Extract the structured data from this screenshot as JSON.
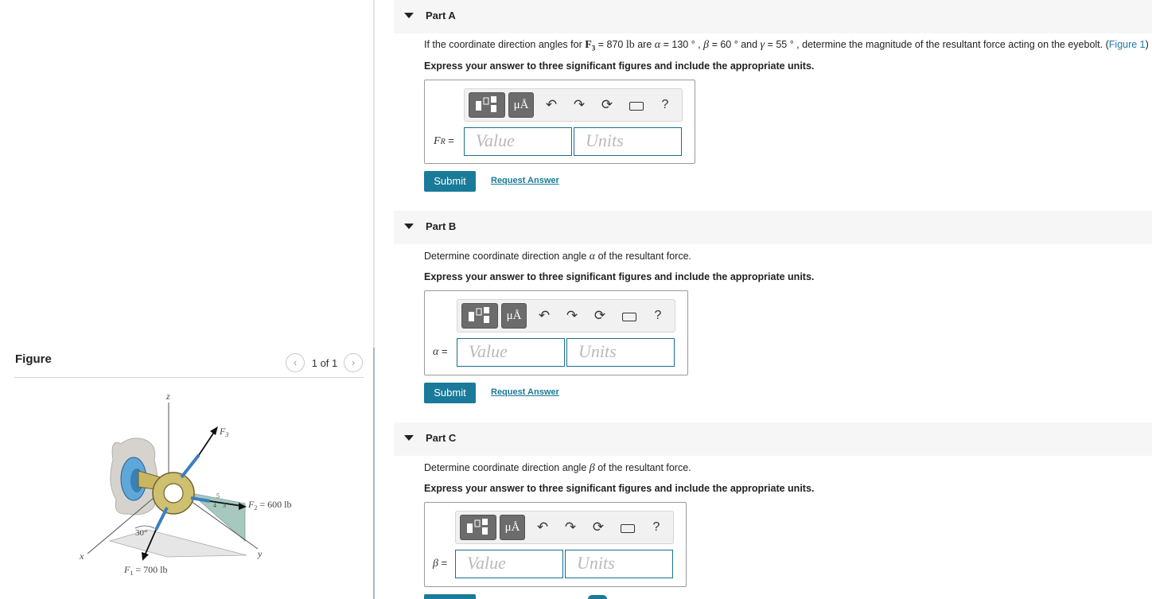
{
  "figure": {
    "title": "Figure",
    "pager": "1 of 1",
    "prev_icon": "‹",
    "next_icon": "›",
    "labels": {
      "z": "z",
      "y": "y",
      "x": "x",
      "f3": "F",
      "f3_sub": "3",
      "f2": "F",
      "f2_sub": "2",
      "f2_value": " = 600 lb",
      "f1": "F",
      "f1_sub": "1",
      "f1_value": " = 700 lb",
      "angle": "30°",
      "slope_5": "5",
      "slope_4": "4",
      "slope_3": "3"
    }
  },
  "toolbar": {
    "units_glyph": "μÅ",
    "undo_glyph": "↶",
    "redo_glyph": "↷",
    "reset_glyph": "⟳",
    "help_glyph": "?"
  },
  "parts": [
    {
      "title": "Part A",
      "question": {
        "prefix": "If the coordinate direction angles for ",
        "force": "F",
        "force_sub": "3",
        "mid1": " = 870 ",
        "unit": "lb",
        "mid2": " are ",
        "alpha": "α",
        "alpha_val": " = 130 ° , ",
        "beta": "β",
        "beta_val": " = 60 ° and ",
        "gamma": "γ",
        "gamma_val": " = 55 ° , determine the magnitude of the resultant force acting on the eyebolt. (",
        "link": "Figure 1",
        "close": ")"
      },
      "instruction": "Express your answer to three significant figures and include the appropriate units.",
      "variable": "F",
      "variable_sub": "R",
      "equals": " =",
      "value_placeholder": "Value",
      "units_placeholder": "Units",
      "submit": "Submit",
      "request": "Request Answer"
    },
    {
      "title": "Part B",
      "question_prefix": "Determine coordinate direction angle ",
      "question_symbol": "α",
      "question_suffix": " of the resultant force.",
      "instruction": "Express your answer to three significant figures and include the appropriate units.",
      "variable": "α",
      "equals": " =",
      "value_placeholder": "Value",
      "units_placeholder": "Units",
      "submit": "Submit",
      "request": "Request Answer"
    },
    {
      "title": "Part C",
      "question_prefix": "Determine coordinate direction angle ",
      "question_symbol": "β",
      "question_suffix": " of the resultant force.",
      "instruction": "Express your answer to three significant figures and include the appropriate units.",
      "variable": "β",
      "equals": " =",
      "value_placeholder": "Value",
      "units_placeholder": "Units"
    }
  ]
}
